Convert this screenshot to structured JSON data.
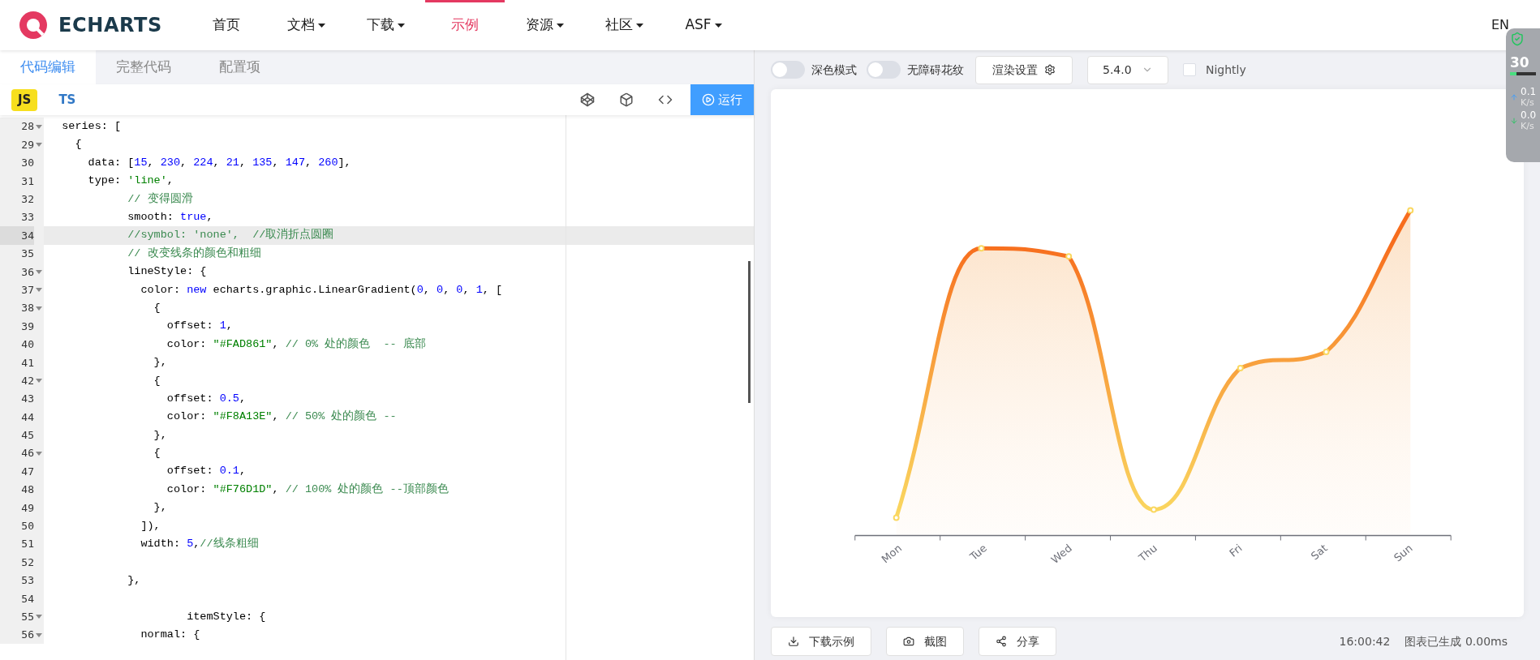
{
  "nav": {
    "brand": "ECHARTS",
    "items": [
      {
        "label": "首页",
        "selected": false,
        "dropdown": false
      },
      {
        "label": "文档",
        "selected": false,
        "dropdown": true
      },
      {
        "label": "下载",
        "selected": false,
        "dropdown": true
      },
      {
        "label": "示例",
        "selected": true,
        "dropdown": false
      },
      {
        "label": "资源",
        "selected": false,
        "dropdown": true
      },
      {
        "label": "社区",
        "selected": false,
        "dropdown": true
      },
      {
        "label": "ASF",
        "selected": false,
        "dropdown": true
      }
    ],
    "language": "EN"
  },
  "editor": {
    "tabs": [
      {
        "label": "代码编辑",
        "selected": true
      },
      {
        "label": "完整代码",
        "selected": false
      },
      {
        "label": "配置项",
        "selected": false
      }
    ],
    "languages": [
      {
        "label": "JS",
        "selected": true
      },
      {
        "label": "TS",
        "selected": false
      }
    ],
    "run_button": "运行",
    "lines": [
      {
        "num": "28",
        "fold": true,
        "active": false,
        "segments": [
          {
            "kind": "plain",
            "text": "  series: ["
          }
        ]
      },
      {
        "num": "29",
        "fold": true,
        "active": false,
        "segments": [
          {
            "kind": "plain",
            "text": "    {"
          }
        ]
      },
      {
        "num": "30",
        "fold": false,
        "active": false,
        "segments": [
          {
            "kind": "plain",
            "text": "      data: ["
          },
          {
            "kind": "number",
            "text": "15"
          },
          {
            "kind": "plain",
            "text": ", "
          },
          {
            "kind": "number",
            "text": "230"
          },
          {
            "kind": "plain",
            "text": ", "
          },
          {
            "kind": "number",
            "text": "224"
          },
          {
            "kind": "plain",
            "text": ", "
          },
          {
            "kind": "number",
            "text": "21"
          },
          {
            "kind": "plain",
            "text": ", "
          },
          {
            "kind": "number",
            "text": "135"
          },
          {
            "kind": "plain",
            "text": ", "
          },
          {
            "kind": "number",
            "text": "147"
          },
          {
            "kind": "plain",
            "text": ", "
          },
          {
            "kind": "number",
            "text": "260"
          },
          {
            "kind": "plain",
            "text": "],"
          }
        ]
      },
      {
        "num": "31",
        "fold": false,
        "active": false,
        "segments": [
          {
            "kind": "plain",
            "text": "      type: "
          },
          {
            "kind": "string",
            "text": "'line'"
          },
          {
            "kind": "plain",
            "text": ","
          }
        ]
      },
      {
        "num": "32",
        "fold": false,
        "active": false,
        "segments": [
          {
            "kind": "comment",
            "text": "            // 变得圆滑"
          }
        ]
      },
      {
        "num": "33",
        "fold": false,
        "active": false,
        "segments": [
          {
            "kind": "plain",
            "text": "            smooth: "
          },
          {
            "kind": "keyword",
            "text": "true"
          },
          {
            "kind": "plain",
            "text": ","
          }
        ]
      },
      {
        "num": "34",
        "fold": false,
        "active": true,
        "segments": [
          {
            "kind": "comment",
            "text": "            //symbol: 'none',  //取消折点圆圈"
          }
        ]
      },
      {
        "num": "35",
        "fold": false,
        "active": false,
        "segments": [
          {
            "kind": "comment",
            "text": "            // 改变线条的颜色和粗细"
          }
        ]
      },
      {
        "num": "36",
        "fold": true,
        "active": false,
        "segments": [
          {
            "kind": "plain",
            "text": "            lineStyle: {"
          }
        ]
      },
      {
        "num": "37",
        "fold": true,
        "active": false,
        "segments": [
          {
            "kind": "plain",
            "text": "              color: "
          },
          {
            "kind": "keyword",
            "text": "new"
          },
          {
            "kind": "plain",
            "text": " echarts.graphic.LinearGradient("
          },
          {
            "kind": "number",
            "text": "0"
          },
          {
            "kind": "plain",
            "text": ", "
          },
          {
            "kind": "number",
            "text": "0"
          },
          {
            "kind": "plain",
            "text": ", "
          },
          {
            "kind": "number",
            "text": "0"
          },
          {
            "kind": "plain",
            "text": ", "
          },
          {
            "kind": "number",
            "text": "1"
          },
          {
            "kind": "plain",
            "text": ", ["
          }
        ]
      },
      {
        "num": "38",
        "fold": true,
        "active": false,
        "segments": [
          {
            "kind": "plain",
            "text": "                {"
          }
        ]
      },
      {
        "num": "39",
        "fold": false,
        "active": false,
        "segments": [
          {
            "kind": "plain",
            "text": "                  offset: "
          },
          {
            "kind": "number",
            "text": "1"
          },
          {
            "kind": "plain",
            "text": ","
          }
        ]
      },
      {
        "num": "40",
        "fold": false,
        "active": false,
        "segments": [
          {
            "kind": "plain",
            "text": "                  color: "
          },
          {
            "kind": "string",
            "text": "\"#FAD861\""
          },
          {
            "kind": "plain",
            "text": ", "
          },
          {
            "kind": "comment",
            "text": "// 0% 处的颜色  -- 底部"
          }
        ]
      },
      {
        "num": "41",
        "fold": false,
        "active": false,
        "segments": [
          {
            "kind": "plain",
            "text": "                },"
          }
        ]
      },
      {
        "num": "42",
        "fold": true,
        "active": false,
        "segments": [
          {
            "kind": "plain",
            "text": "                {"
          }
        ]
      },
      {
        "num": "43",
        "fold": false,
        "active": false,
        "segments": [
          {
            "kind": "plain",
            "text": "                  offset: "
          },
          {
            "kind": "number",
            "text": "0.5"
          },
          {
            "kind": "plain",
            "text": ","
          }
        ]
      },
      {
        "num": "44",
        "fold": false,
        "active": false,
        "segments": [
          {
            "kind": "plain",
            "text": "                  color: "
          },
          {
            "kind": "string",
            "text": "\"#F8A13E\""
          },
          {
            "kind": "plain",
            "text": ", "
          },
          {
            "kind": "comment",
            "text": "// 50% 处的颜色 --"
          }
        ]
      },
      {
        "num": "45",
        "fold": false,
        "active": false,
        "segments": [
          {
            "kind": "plain",
            "text": "                },"
          }
        ]
      },
      {
        "num": "46",
        "fold": true,
        "active": false,
        "segments": [
          {
            "kind": "plain",
            "text": "                {"
          }
        ]
      },
      {
        "num": "47",
        "fold": false,
        "active": false,
        "segments": [
          {
            "kind": "plain",
            "text": "                  offset: "
          },
          {
            "kind": "number",
            "text": "0.1"
          },
          {
            "kind": "plain",
            "text": ","
          }
        ]
      },
      {
        "num": "48",
        "fold": false,
        "active": false,
        "segments": [
          {
            "kind": "plain",
            "text": "                  color: "
          },
          {
            "kind": "string",
            "text": "\"#F76D1D\""
          },
          {
            "kind": "plain",
            "text": ", "
          },
          {
            "kind": "comment",
            "text": "// 100% 处的颜色 --顶部颜色"
          }
        ]
      },
      {
        "num": "49",
        "fold": false,
        "active": false,
        "segments": [
          {
            "kind": "plain",
            "text": "                },"
          }
        ]
      },
      {
        "num": "50",
        "fold": false,
        "active": false,
        "segments": [
          {
            "kind": "plain",
            "text": "              ]),"
          }
        ]
      },
      {
        "num": "51",
        "fold": false,
        "active": false,
        "segments": [
          {
            "kind": "plain",
            "text": "              width: "
          },
          {
            "kind": "number",
            "text": "5"
          },
          {
            "kind": "plain",
            "text": ","
          },
          {
            "kind": "comment",
            "text": "//线条粗细"
          }
        ]
      },
      {
        "num": "52",
        "fold": false,
        "active": false
      },
      {
        "num": "53",
        "fold": false,
        "active": false,
        "segments": [
          {
            "kind": "plain",
            "text": "            },"
          }
        ]
      },
      {
        "num": "54",
        "fold": false,
        "active": false
      },
      {
        "num": "55",
        "fold": true,
        "active": false,
        "segments": [
          {
            "kind": "plain",
            "text": "                     itemStyle: {"
          }
        ]
      },
      {
        "num": "56",
        "fold": true,
        "active": false,
        "segments": [
          {
            "kind": "plain",
            "text": "              normal: {"
          }
        ]
      }
    ]
  },
  "preview": {
    "toggles": [
      {
        "label": "深色模式",
        "on": false
      },
      {
        "label": "无障碍花纹",
        "on": false
      }
    ],
    "render_settings": "渲染设置",
    "version": "5.4.0",
    "nightly": {
      "label": "Nightly",
      "checked": false
    },
    "chart": {
      "categories": [
        "Mon",
        "Tue",
        "Wed",
        "Thu",
        "Fri",
        "Sat",
        "Sun"
      ]
    },
    "actions": [
      "下载示例",
      "截图",
      "分享"
    ],
    "time": "16:00:42",
    "status": "图表已生成 0.00ms"
  },
  "monitor": {
    "value": "30",
    "up": "0.1",
    "up_unit": "K/s",
    "down": "0.0",
    "down_unit": "K/s"
  }
}
